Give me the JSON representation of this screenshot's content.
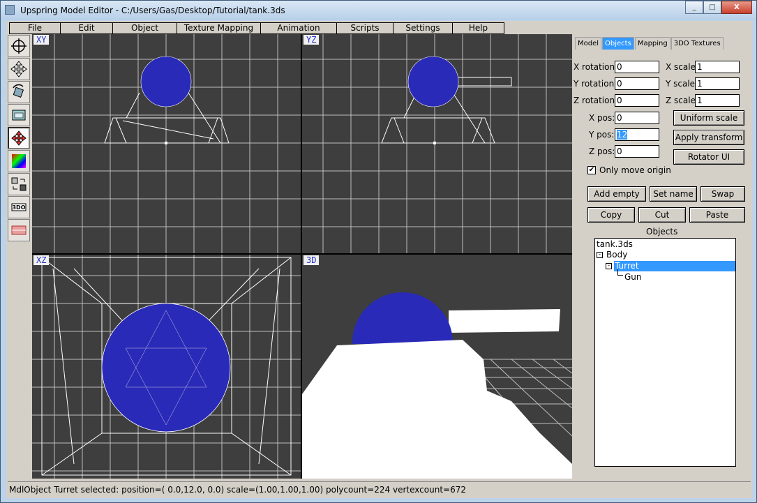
{
  "window": {
    "title": "Upspring Model Editor - C:/Users/Gas/Desktop/Tutorial/tank.3ds",
    "minimize": "_",
    "maximize": "□",
    "close": "X"
  },
  "menu": [
    "File",
    "Edit",
    "Object",
    "Texture Mapping",
    "Animation",
    "Scripts",
    "Settings",
    "Help"
  ],
  "toolbox": [
    "camera-tool-icon",
    "move-tool-icon",
    "rotate-tool-icon",
    "texture-tool-icon",
    "origin-tool-icon",
    "color-tool-icon",
    "texture-swap-icon",
    "3do-tool-icon",
    "texture-flip-icon"
  ],
  "viewports": {
    "xy": "XY",
    "yz": "YZ",
    "xz": "XZ",
    "persp": "3D"
  },
  "tabs": [
    "Model",
    "Objects",
    "Mapping",
    "3DO Textures"
  ],
  "active_tab": "Objects",
  "transform": {
    "x_rotation_label": "X rotation:",
    "x_rotation": "0",
    "y_rotation_label": "Y rotation:",
    "y_rotation": "0",
    "z_rotation_label": "Z rotation:",
    "z_rotation": "0",
    "x_scale_label": "X scale",
    "x_scale": "1",
    "y_scale_label": "Y scale",
    "y_scale": "1",
    "z_scale_label": "Z scale",
    "z_scale": "1",
    "x_pos_label": "X pos:",
    "x_pos": "0",
    "y_pos_label": "Y pos:",
    "y_pos": "12",
    "z_pos_label": "Z pos:",
    "z_pos": "0"
  },
  "buttons": {
    "uniform_scale": "Uniform scale",
    "apply_transform": "Apply transform",
    "rotator_ui": "Rotator UI",
    "add_empty": "Add empty",
    "set_name": "Set name",
    "swap": "Swap",
    "copy": "Copy",
    "cut": "Cut",
    "paste": "Paste"
  },
  "only_move_origin": {
    "label": "Only move origin",
    "checked": true,
    "mark": "✔"
  },
  "objects": {
    "heading": "Objects",
    "tree": [
      {
        "label": "tank.3ds"
      },
      {
        "label": "Body"
      },
      {
        "label": "Turret"
      },
      {
        "label": "Gun"
      }
    ],
    "expander": "-",
    "selected": "Turret"
  },
  "status": "MdlObject Turret selected: position=( 0.0,12.0, 0.0) scale=(1.00,1.00,1.00) polycount=224 vertexcount=672",
  "colors": {
    "viewport_bg": "#3e3e3e",
    "mesh_fill": "#2a2ab8",
    "selection": "#3399ff"
  }
}
